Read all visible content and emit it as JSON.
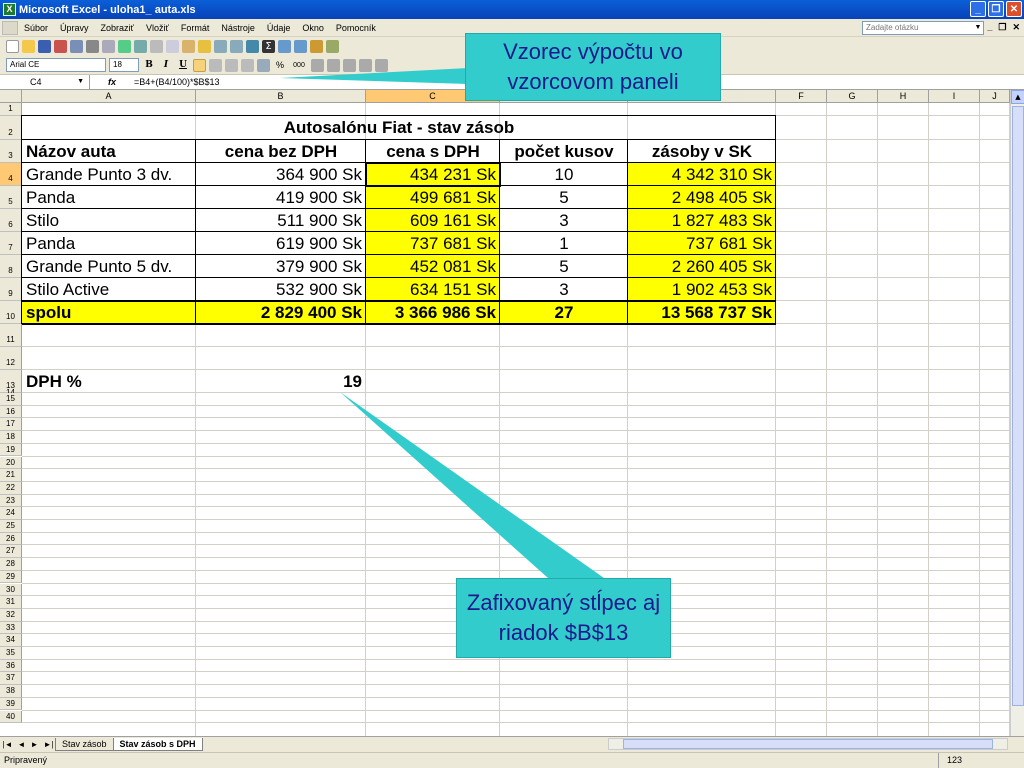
{
  "window": {
    "title": "Microsoft Excel - uloha1_ auta.xls",
    "app_icon": "excel-icon"
  },
  "menu": {
    "items": [
      "Súbor",
      "Úpravy",
      "Zobraziť",
      "Vložiť",
      "Formát",
      "Nástroje",
      "Údaje",
      "Okno",
      "Pomocník"
    ]
  },
  "help": {
    "placeholder": "Zadajte otázku"
  },
  "format_toolbar": {
    "font": "Arial CE",
    "size": "18",
    "bold": "B",
    "italic": "I",
    "underline": "U",
    "percent": "%",
    "thousands": "000"
  },
  "formula_bar": {
    "cell_ref": "C4",
    "fx": "fx",
    "formula": "=B4+(B4/100)*$B$13"
  },
  "columns": [
    "A",
    "B",
    "C",
    "D",
    "E",
    "F",
    "G",
    "H",
    "I",
    "J"
  ],
  "selected_column": "C",
  "selected_row": "4",
  "sheet": {
    "title": "Autosalónu Fiat - stav zásob",
    "headers": [
      "Názov auta",
      "cena bez DPH",
      "cena s DPH",
      "počet kusov",
      "zásoby v SK"
    ],
    "rows": [
      [
        "Grande Punto 3 dv.",
        "364 900 Sk",
        "434 231 Sk",
        "10",
        "4 342 310 Sk"
      ],
      [
        "Panda",
        "419 900 Sk",
        "499 681 Sk",
        "5",
        "2 498 405 Sk"
      ],
      [
        "Stilo",
        "511 900 Sk",
        "609 161 Sk",
        "3",
        "1 827 483 Sk"
      ],
      [
        "Panda",
        "619 900 Sk",
        "737 681 Sk",
        "1",
        "737 681 Sk"
      ],
      [
        "Grande Punto 5 dv.",
        "379 900 Sk",
        "452 081 Sk",
        "5",
        "2 260 405 Sk"
      ],
      [
        "Stilo  Active",
        "532 900 Sk",
        "634 151 Sk",
        "3",
        "1 902 453 Sk"
      ]
    ],
    "total": [
      "spolu",
      "2 829 400 Sk",
      "3 366 986 Sk",
      "27",
      "13 568 737 Sk"
    ],
    "dph_label": "DPH %",
    "dph_value": "19"
  },
  "callouts": {
    "formula": "Vzorec výpočtu vo vzorcovom paneli",
    "fixed": "Zafixovaný stĺpec aj riadok $B$13"
  },
  "sheet_tabs": [
    "Stav zásob",
    "Stav zásob s DPH"
  ],
  "active_tab": "Stav zásob s DPH",
  "status": {
    "text": "Pripravený",
    "num": "123"
  },
  "colors": {
    "highlight": "#ffff00",
    "callout": "#33cccc",
    "callout_text": "#1a1a8c"
  }
}
